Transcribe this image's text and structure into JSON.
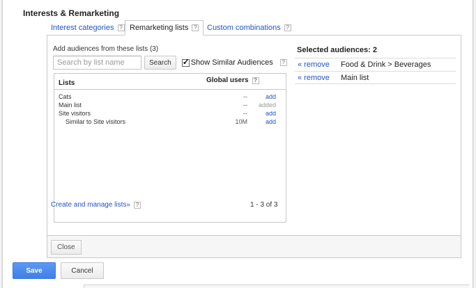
{
  "dialog": {
    "title": "Interests & Remarketing"
  },
  "tabs": [
    {
      "label": "Interest categories",
      "help": "?"
    },
    {
      "label": "Remarketing lists",
      "help": "?"
    },
    {
      "label": "Custom combinations",
      "help": "?"
    }
  ],
  "available": {
    "heading": "Add audiences from these lists (3)",
    "search_placeholder": "Search by list name",
    "search_button": "Search",
    "similar_label": "Show Similar Audiences",
    "similar_checked": true,
    "help": "?"
  },
  "list_table": {
    "col_lists": "Lists",
    "col_global": "Global users",
    "col_help": "?",
    "rows": [
      {
        "name": "Cats",
        "users": "--",
        "action": "add"
      },
      {
        "name": "Main list",
        "users": "--",
        "action": "added"
      },
      {
        "name": "Site visitors",
        "users": "--",
        "action": "add"
      },
      {
        "name": "Similar to Site visitors",
        "users": "10M",
        "action": "add"
      }
    ],
    "manage_link": "Create and manage lists»",
    "manage_help": "?",
    "pager": "1 - 3 of 3"
  },
  "selected": {
    "title": "Selected audiences: 2",
    "items": [
      {
        "remove": "« remove",
        "name": "Food & Drink > Beverages"
      },
      {
        "remove": "« remove",
        "name": "Main list"
      }
    ]
  },
  "buttons": {
    "close": "Close",
    "save": "Save",
    "cancel": "Cancel"
  },
  "colors": {
    "link": "#2255c4",
    "save_button": "#4a8af0"
  }
}
